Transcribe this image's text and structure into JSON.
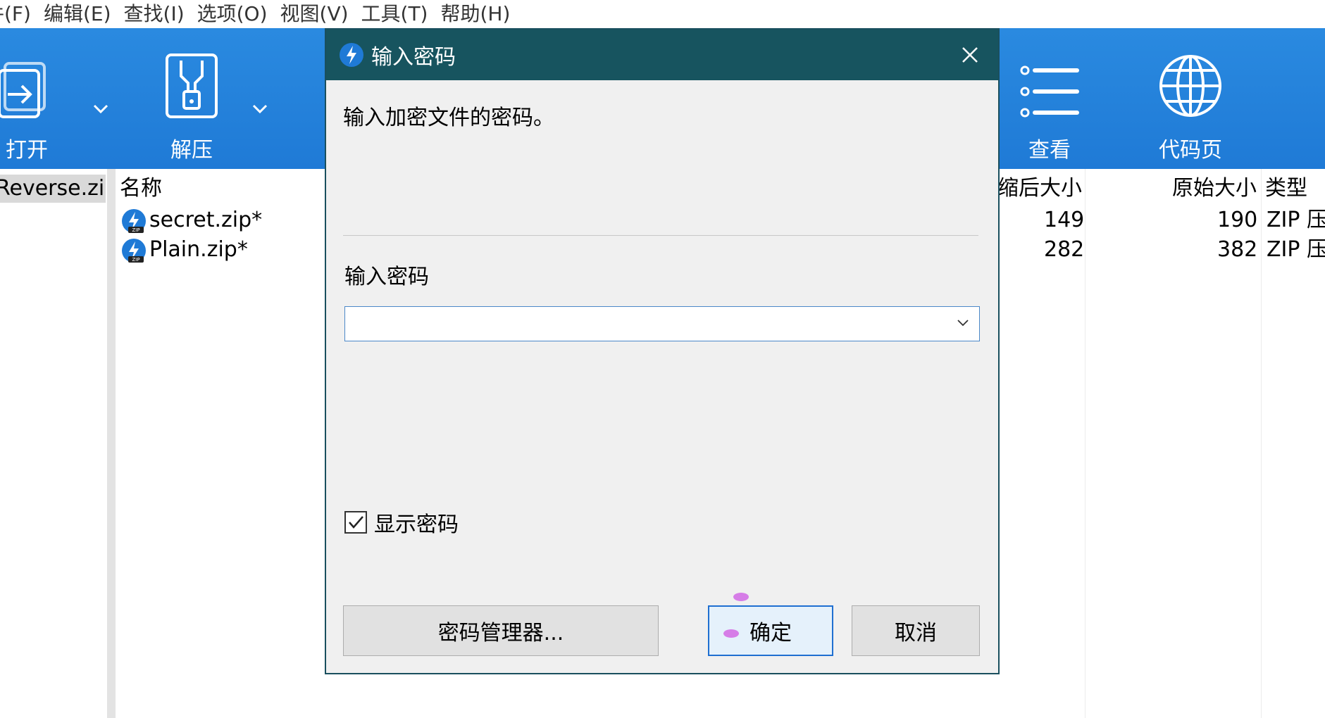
{
  "menu": {
    "items": [
      "件(F)",
      "编辑(E)",
      "查找(I)",
      "选项(O)",
      "视图(V)",
      "工具(T)",
      "帮助(H)"
    ]
  },
  "toolbar": {
    "open_label": "打开",
    "extract_label": "解压",
    "view_label": "查看",
    "codepage_label": "代码页",
    "bg_color": "#1f7ad6"
  },
  "tree": {
    "selected_item": "Reverse.zip"
  },
  "filelist": {
    "columns": {
      "name": "名称",
      "packed_size": "缩后大小",
      "original_size": "原始大小",
      "type": "类型"
    },
    "rows": [
      {
        "name": "secret.zip*",
        "packed_size": "149",
        "original_size": "190",
        "type": "ZIP 压"
      },
      {
        "name": "Plain.zip*",
        "packed_size": "282",
        "original_size": "382",
        "type": "ZIP 压"
      }
    ]
  },
  "dialog": {
    "title": "输入密码",
    "message": "输入加密文件的密码。",
    "password_label": "输入密码",
    "password_value": "",
    "show_password_label": "显示密码",
    "show_password_checked": true,
    "password_manager_button": "密码管理器...",
    "ok_button": "确定",
    "cancel_button": "取消",
    "title_bar_color": "#17545f"
  }
}
